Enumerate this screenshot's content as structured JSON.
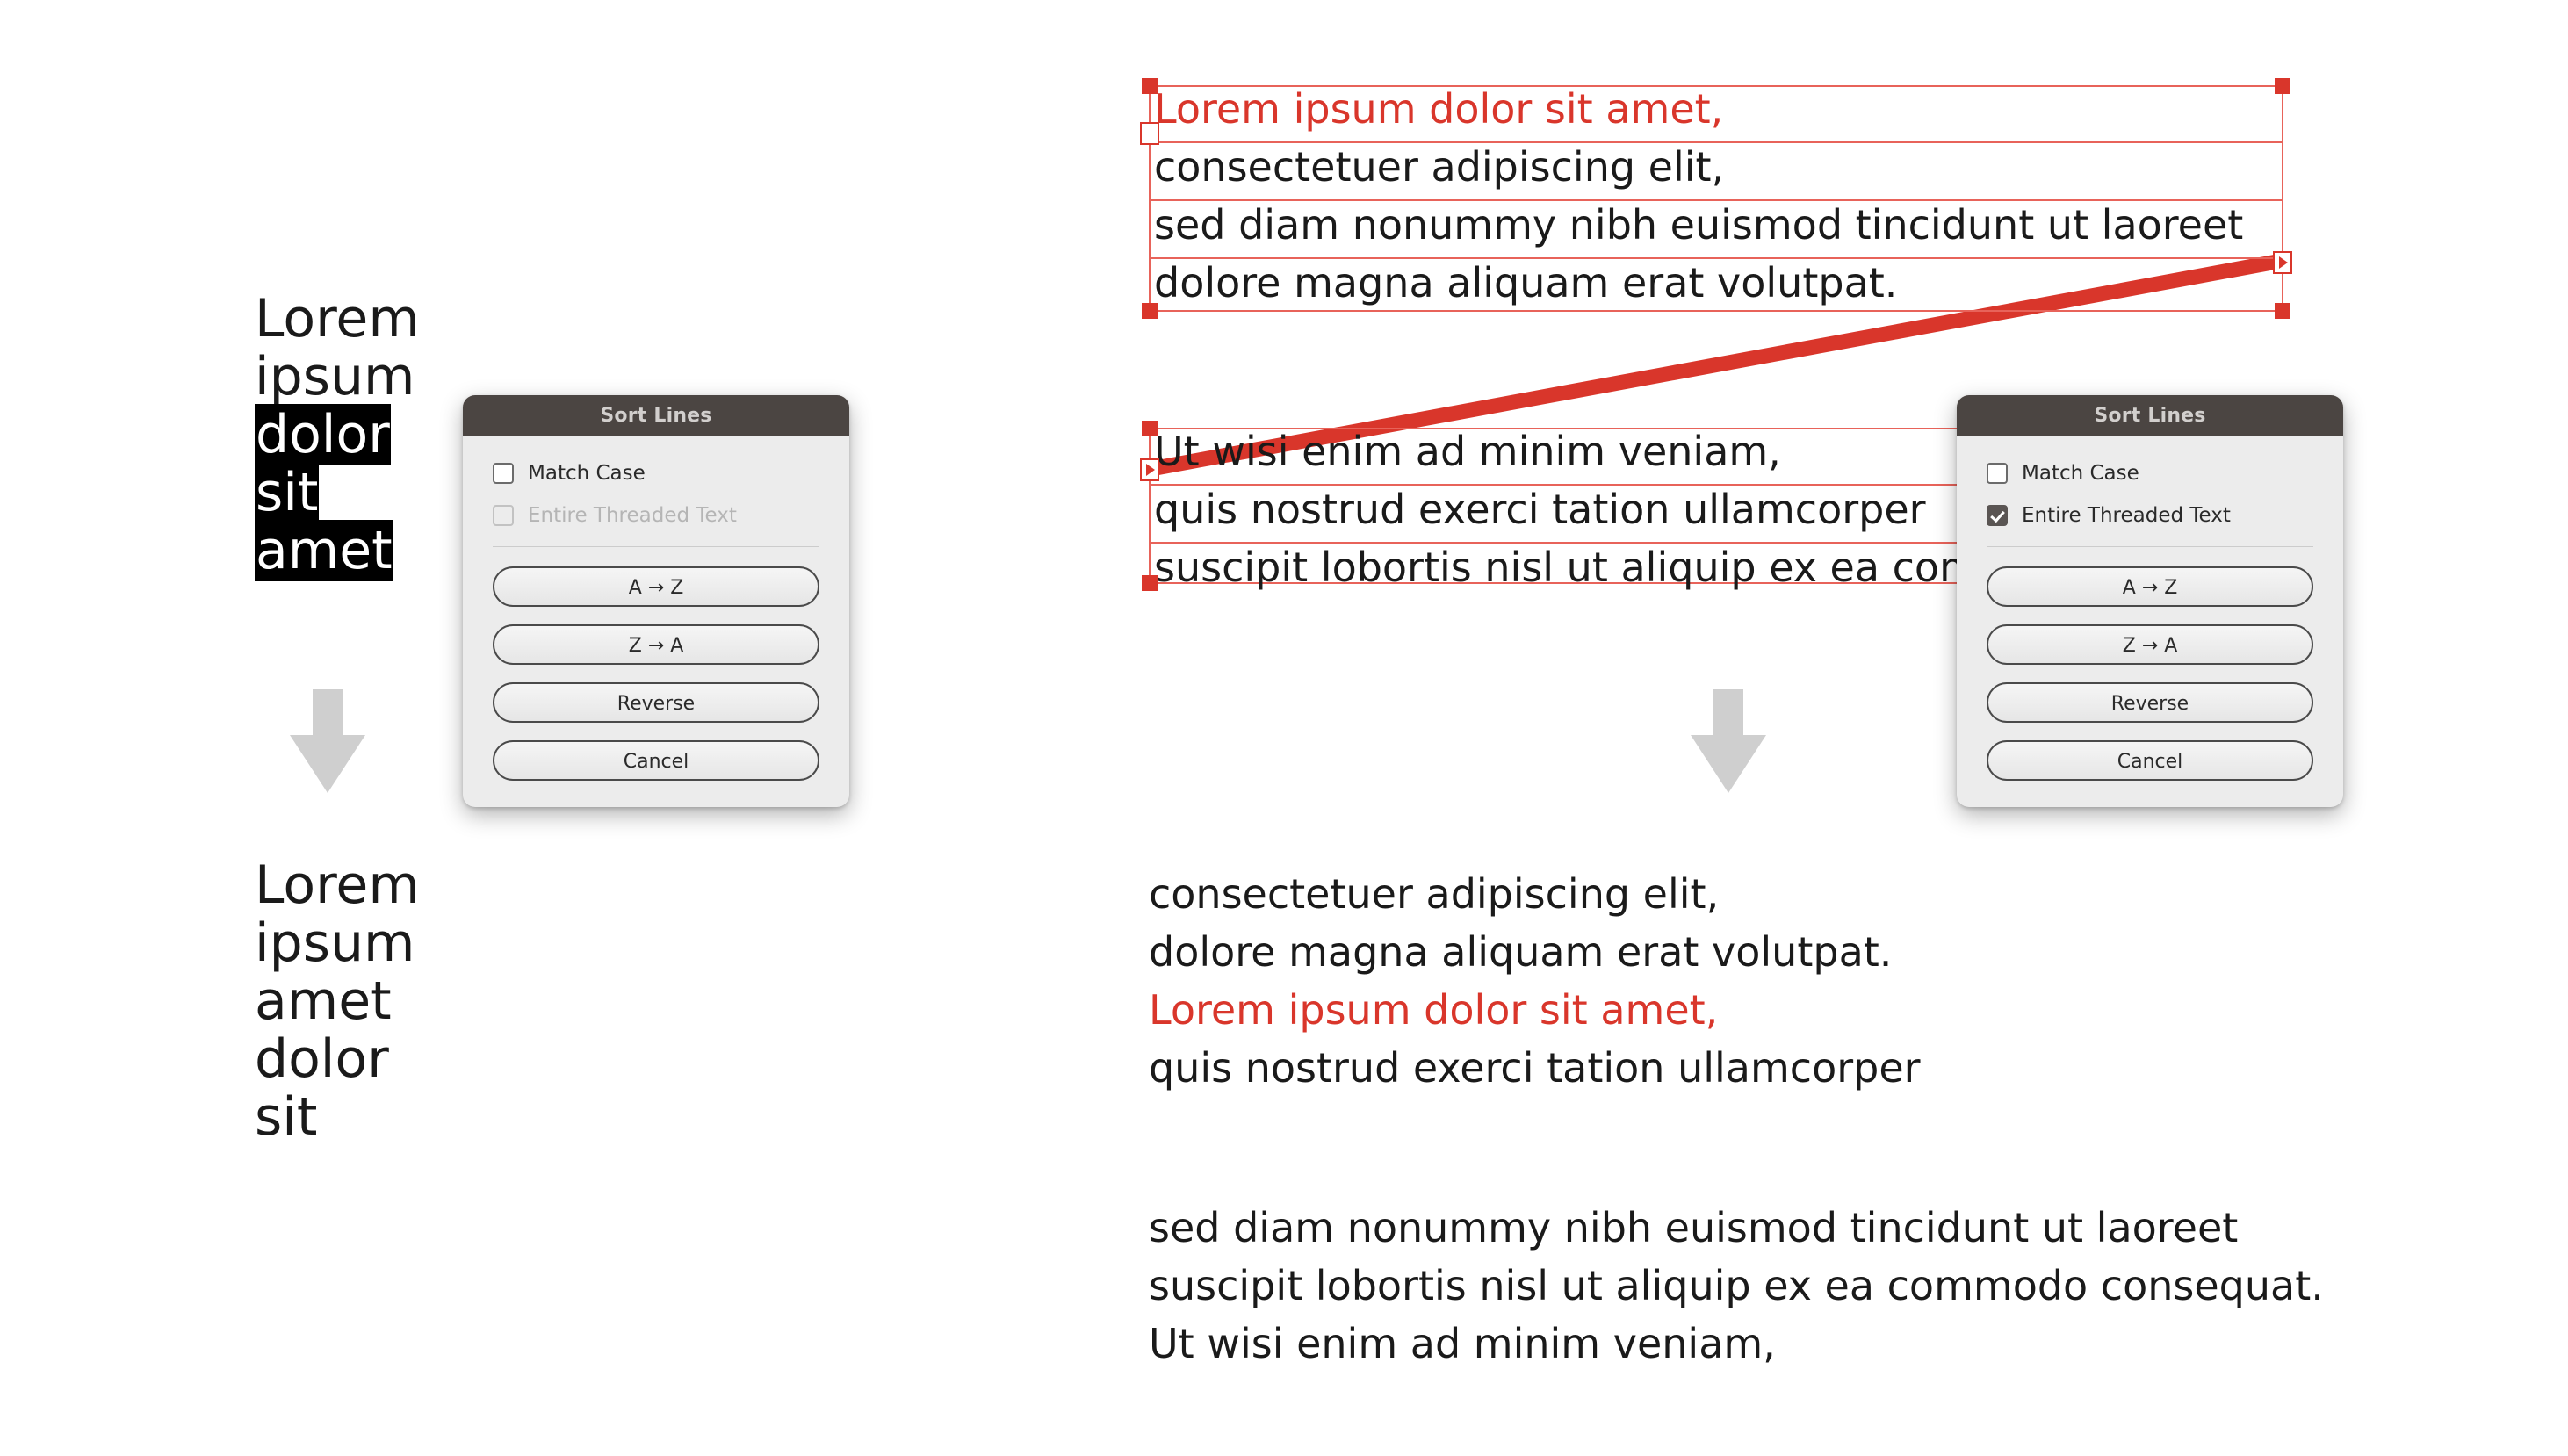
{
  "left_example": {
    "before_lines": [
      {
        "text": "Lorem",
        "selected": false
      },
      {
        "text": "ipsum",
        "selected": false
      },
      {
        "text": "dolor",
        "selected": true
      },
      {
        "text": "sit",
        "selected": true
      },
      {
        "text": "amet",
        "selected": true
      }
    ],
    "after_lines": [
      "Lorem",
      "ipsum",
      "amet",
      "dolor",
      "sit"
    ],
    "arrow_icon": "arrow-down-icon"
  },
  "right_example": {
    "frame_1_lines": [
      {
        "text": "Lorem ipsum dolor sit amet,",
        "color": "red"
      },
      {
        "text": "consectetuer adipiscing elit,",
        "color": "black"
      },
      {
        "text": "sed diam nonummy nibh euismod tincidunt ut laoreet",
        "color": "black"
      },
      {
        "text": "dolore magna aliquam erat volutpat.",
        "color": "black"
      }
    ],
    "frame_2_lines": [
      {
        "text": "Ut wisi enim ad minim veniam,",
        "color": "black"
      },
      {
        "text": "quis nostrud exerci tation ullamcorper",
        "color": "black"
      },
      {
        "text": "suscipit lobortis nisl ut aliquip ex ea commodo consequat.",
        "color": "black"
      }
    ],
    "out_lines_1": [
      {
        "text": "consectetuer adipiscing elit,",
        "color": "black"
      },
      {
        "text": "dolore magna aliquam erat volutpat.",
        "color": "black"
      },
      {
        "text": "Lorem ipsum dolor sit amet,",
        "color": "red"
      },
      {
        "text": "quis nostrud exerci tation ullamcorper",
        "color": "black"
      }
    ],
    "out_lines_2": [
      {
        "text": "sed diam nonummy nibh euismod tincidunt ut laoreet",
        "color": "black"
      },
      {
        "text": "suscipit lobortis nisl ut aliquip ex ea commodo consequat.",
        "color": "black"
      },
      {
        "text": "Ut wisi enim ad minim veniam,",
        "color": "black"
      }
    ],
    "arrow_icon": "arrow-down-icon",
    "in_port_icon": "text-in-port-icon",
    "out_port_icon": "text-out-port-icon",
    "thread_link_label": "threaded-text-link"
  },
  "dialog_left": {
    "title": "Sort Lines",
    "match_case": {
      "label": "Match Case",
      "checked": false,
      "disabled": false
    },
    "entire_threaded_text": {
      "label": "Entire Threaded Text",
      "checked": false,
      "disabled": true
    },
    "buttons": [
      "A → Z",
      "Z → A",
      "Reverse",
      "Cancel"
    ]
  },
  "dialog_right": {
    "title": "Sort Lines",
    "match_case": {
      "label": "Match Case",
      "checked": false,
      "disabled": false
    },
    "entire_threaded_text": {
      "label": "Entire Threaded Text",
      "checked": true,
      "disabled": false
    },
    "buttons": [
      "A → Z",
      "Z → A",
      "Reverse",
      "Cancel"
    ]
  },
  "colors": {
    "selection_highlight": "#000000",
    "frame_stroke": "#e8635a",
    "handle": "#d9362b",
    "accent_red": "#d9362b",
    "arrow_gray": "#cfcfcf",
    "dialog_titlebar": "#4b4542",
    "dialog_body": "#ececec"
  }
}
